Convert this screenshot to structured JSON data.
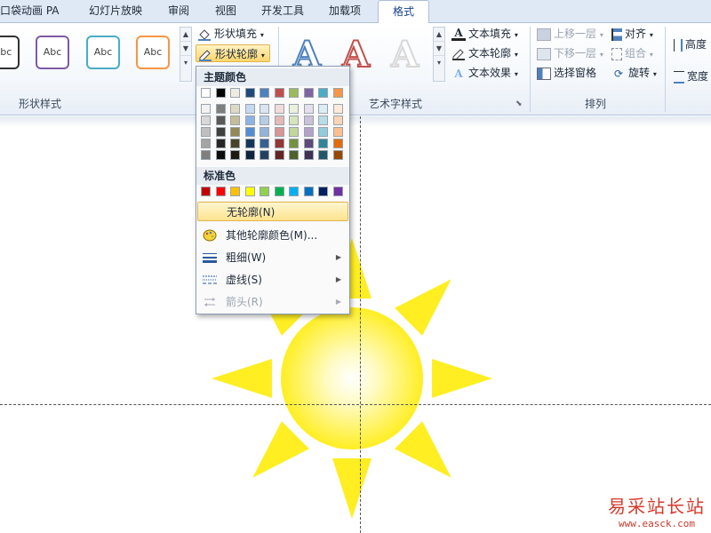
{
  "tabs": [
    {
      "label": "口袋动画 PA"
    },
    {
      "label": "幻灯片放映"
    },
    {
      "label": "审阅"
    },
    {
      "label": "视图"
    },
    {
      "label": "开发工具"
    },
    {
      "label": "加载项"
    },
    {
      "label": "格式"
    }
  ],
  "ribbon": {
    "shape_styles": {
      "label": "形状样式",
      "presets": [
        {
          "text": "Abc",
          "color": "#333333"
        },
        {
          "text": "Abc",
          "color": "#7d5ba6"
        },
        {
          "text": "Abc",
          "color": "#4bacc6"
        },
        {
          "text": "Abc",
          "color": "#f79646"
        }
      ],
      "fill_button": "形状填充",
      "outline_button": "形状轮廓"
    },
    "wordart": {
      "label": "艺术字样式",
      "letters": [
        "A",
        "A",
        "A"
      ],
      "text_fill": "文本填充",
      "text_outline": "文本轮廓",
      "text_effects": "文本效果"
    },
    "arrange": {
      "label": "排列",
      "bring_forward": "上移一层",
      "send_backward": "下移一层",
      "selection_pane": "选择窗格",
      "align": "对齐",
      "group": "组合",
      "rotate": "旋转"
    },
    "size": {
      "height": "高度",
      "width": "宽度"
    }
  },
  "outline_menu": {
    "theme_header": "主题颜色",
    "standard_header": "标准色",
    "theme_colors": [
      "#ffffff",
      "#000000",
      "#eeece1",
      "#1f497d",
      "#4f81bd",
      "#c0504d",
      "#9bbb59",
      "#8064a2",
      "#4bacc6",
      "#f79646"
    ],
    "theme_shades": [
      [
        "#f2f2f2",
        "#7f7f7f",
        "#ddd9c3",
        "#c6d9f0",
        "#dbe5f1",
        "#f2dcdb",
        "#ebf1dd",
        "#e5e0ec",
        "#dbeef3",
        "#fdeada"
      ],
      [
        "#d8d8d8",
        "#595959",
        "#c4bd97",
        "#8db3e2",
        "#b8cce4",
        "#e5b9b7",
        "#d7e3bc",
        "#ccc1d9",
        "#b7dde8",
        "#fbd5b5"
      ],
      [
        "#bfbfbf",
        "#3f3f3f",
        "#938953",
        "#548dd4",
        "#95b3d7",
        "#d99694",
        "#c3d69b",
        "#b2a2c7",
        "#92cddc",
        "#fac08f"
      ],
      [
        "#a5a5a5",
        "#262626",
        "#494429",
        "#17365d",
        "#366092",
        "#953734",
        "#76923c",
        "#5f497a",
        "#31859b",
        "#e36c09"
      ],
      [
        "#7f7f7f",
        "#0c0c0c",
        "#1d1b10",
        "#0f243e",
        "#244061",
        "#632423",
        "#4f6128",
        "#3f3151",
        "#205867",
        "#974806"
      ]
    ],
    "standard_colors": [
      "#c00000",
      "#ff0000",
      "#ffc000",
      "#ffff00",
      "#92d050",
      "#00b050",
      "#00b0f0",
      "#0070c0",
      "#002060",
      "#7030a0"
    ],
    "items": [
      {
        "label": "无轮廓(N)",
        "submenu": false,
        "disabled": false
      },
      {
        "label": "其他轮廓颜色(M)...",
        "submenu": false,
        "disabled": false
      },
      {
        "label": "粗细(W)",
        "submenu": true,
        "disabled": false
      },
      {
        "label": "虚线(S)",
        "submenu": true,
        "disabled": false
      },
      {
        "label": "箭头(R)",
        "submenu": true,
        "disabled": true
      }
    ]
  },
  "slide": {
    "sun_color": "#ffee22"
  },
  "watermark": {
    "cn": "易采站长站",
    "url": "www.easck.com"
  }
}
